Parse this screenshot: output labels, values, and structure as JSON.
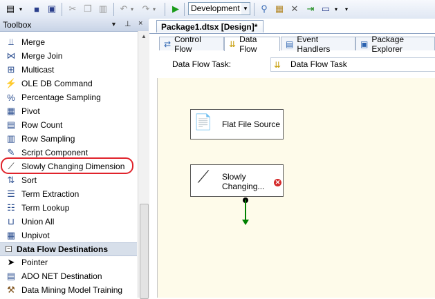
{
  "toolbar": {
    "configuration": "Development",
    "icons": [
      "new-item-icon",
      "save-icon",
      "save-all-icon",
      "cut-icon",
      "copy-icon",
      "paste-icon",
      "undo-icon",
      "redo-icon",
      "start-icon",
      "properties-icon",
      "toolbox-icon",
      "tools-icon",
      "import-icon",
      "command-window-icon"
    ]
  },
  "toolbox": {
    "title": "Toolbox",
    "items": [
      {
        "label": "Merge",
        "icon": "merge-icon"
      },
      {
        "label": "Merge Join",
        "icon": "merge-join-icon"
      },
      {
        "label": "Multicast",
        "icon": "multicast-icon"
      },
      {
        "label": "OLE DB Command",
        "icon": "ole-db-command-icon"
      },
      {
        "label": "Percentage Sampling",
        "icon": "percentage-sampling-icon"
      },
      {
        "label": "Pivot",
        "icon": "pivot-icon"
      },
      {
        "label": "Row Count",
        "icon": "row-count-icon"
      },
      {
        "label": "Row Sampling",
        "icon": "row-sampling-icon"
      },
      {
        "label": "Script Component",
        "icon": "script-component-icon"
      },
      {
        "label": "Slowly Changing Dimension",
        "icon": "slowly-changing-dimension-icon"
      },
      {
        "label": "Sort",
        "icon": "sort-icon"
      },
      {
        "label": "Term Extraction",
        "icon": "term-extraction-icon"
      },
      {
        "label": "Term Lookup",
        "icon": "term-lookup-icon"
      },
      {
        "label": "Union All",
        "icon": "union-all-icon"
      },
      {
        "label": "Unpivot",
        "icon": "unpivot-icon"
      }
    ],
    "group": {
      "label": "Data Flow Destinations",
      "expander": "−"
    },
    "dest_items": [
      {
        "label": "Pointer",
        "icon": "pointer-icon"
      },
      {
        "label": "ADO NET Destination",
        "icon": "ado-net-destination-icon"
      },
      {
        "label": "Data Mining Model Training",
        "icon": "data-mining-model-training-icon"
      }
    ],
    "highlight_color": "#e0232b"
  },
  "designer": {
    "document_tab": "Package1.dtsx [Design]*",
    "tabs": [
      "Control Flow",
      "Data Flow",
      "Event Handlers",
      "Package Explorer"
    ],
    "active_tab": "Data Flow",
    "task_label": "Data Flow Task:",
    "task_value": "Data Flow Task",
    "canvas_color": "#fefbea",
    "components": [
      {
        "label": "Flat File Source",
        "icon": "flat-file-source-icon"
      },
      {
        "label_line1": "Slowly",
        "label_line2": "Changing...",
        "icon": "slowly-changing-dimension-icon",
        "status": "error-icon"
      }
    ],
    "path_color": "#008000"
  }
}
